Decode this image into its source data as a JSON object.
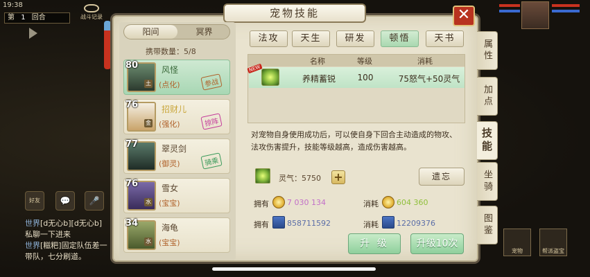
{
  "hud": {
    "time": "19:38",
    "round_prefix": "第",
    "round_number": "1",
    "round_suffix": "回合",
    "battle_record": "战斗记录"
  },
  "chat": {
    "icons": [
      "好友",
      "💬",
      "🎤"
    ],
    "lines": [
      {
        "tag": "世界",
        "text": "[d无心b][d无心b]"
      },
      {
        "tag": "",
        "text": "私聊一下进来"
      },
      {
        "tag": "世界",
        "text": "[糍粑]固定队伍差一"
      },
      {
        "tag": "",
        "text": "带队，七分刷道。"
      }
    ]
  },
  "bottom_right": {
    "btn1": "宠物",
    "btn2": "帮派盗宝"
  },
  "panel": {
    "title": "宠物技能",
    "close": "✕",
    "realm_tabs": [
      "阳间",
      "冥界"
    ],
    "carry_label": "携带数量：",
    "carry_value": "5/8",
    "pets": [
      {
        "level": "80",
        "badge": "土",
        "name": "风怪",
        "type": "(点化)",
        "status": "参战",
        "status_color": "#b0622b",
        "portrait_top": "#6a8a6e",
        "portrait_bottom": "#2c3a2e"
      },
      {
        "level": "76",
        "badge": "金",
        "name": "招财儿",
        "type": "(强化)",
        "status": "掠阵",
        "status_color": "#c43a9a",
        "portrait_top": "#f4efe2",
        "portrait_bottom": "#c9a36a"
      },
      {
        "level": "77",
        "badge": "",
        "name": "翠灵剑",
        "type": "(御灵)",
        "status": "骑乘",
        "status_color": "#3a9a5a",
        "portrait_top": "#5a7a6a",
        "portrait_bottom": "#1f2c26"
      },
      {
        "level": "76",
        "badge": "水",
        "name": "雪女",
        "type": "(宝宝)",
        "status": "",
        "status_color": "#000000",
        "portrait_top": "#7a6aa8",
        "portrait_bottom": "#3a2c5a"
      },
      {
        "level": "34",
        "badge": "水",
        "name": "海龟",
        "type": "(宝宝)",
        "status": "",
        "status_color": "#000000",
        "portrait_top": "#9aa86a",
        "portrait_bottom": "#4a5a2c"
      }
    ],
    "skill_tabs": [
      "法攻",
      "天生",
      "研发",
      "顿悟",
      "天书"
    ],
    "active_skill_tab": 3,
    "table_headers": [
      "名称",
      "等级",
      "消耗"
    ],
    "skill": {
      "new_badge": "NEW",
      "name": "养精蓄锐",
      "level": "100",
      "cost": "75怒气+50灵气"
    },
    "description": "对宠物自身使用成功后，可以使自身下回合主动造成的物攻、法攻伤害提升，技能等级越高，造成伤害越高。",
    "spirit_label": "灵气：",
    "spirit_value": "5750",
    "add_spirit": "+",
    "forget_button": "遗忘",
    "own_label": "拥有",
    "cost_label": "消耗",
    "own_coin": "7 030 134",
    "cost_coin": "604 360",
    "own_book": "858711592",
    "cost_book": "12209376",
    "upgrade_button": "升 级",
    "upgrade10_button": "升级10次",
    "side_tabs": [
      "属性",
      "加点",
      "技能",
      "坐骑",
      "图鉴"
    ],
    "active_side_tab": 2
  },
  "colors": {
    "own_coin": "#c270c8",
    "cost_coin": "#8fbf3a",
    "book_value": "#5b6ea8"
  }
}
